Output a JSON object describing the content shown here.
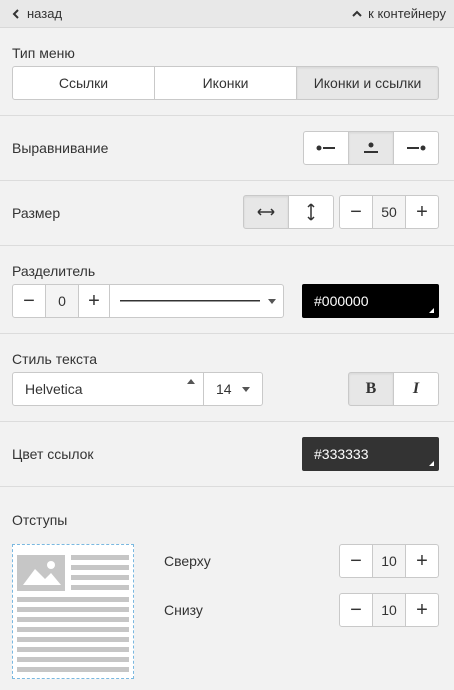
{
  "nav": {
    "back_label": "назад",
    "container_label": "к контейнеру"
  },
  "menu_type": {
    "label": "Тип меню",
    "options": [
      "Ссылки",
      "Иконки",
      "Иконки и ссылки"
    ],
    "selected": "Иконки и ссылки"
  },
  "alignment": {
    "label": "Выравнивание",
    "options": [
      "align-left-icon",
      "align-center-icon",
      "align-right-icon"
    ],
    "selected": "align-center-icon"
  },
  "size": {
    "label": "Размер",
    "modes": [
      "width-icon",
      "height-icon"
    ],
    "selected_mode": "width-icon",
    "minus": "−",
    "value": "50",
    "plus": "+"
  },
  "divider": {
    "label": "Разделитель",
    "minus": "−",
    "value": "0",
    "plus": "+",
    "style_icon": "solid-line-icon",
    "color": "#000000"
  },
  "text_style": {
    "label": "Стиль текста",
    "font": "Helvetica",
    "size": "14",
    "bold_label": "B",
    "italic_label": "I",
    "bold_active": true
  },
  "link_color": {
    "label": "Цвет ссылок",
    "color": "#333333"
  },
  "padding": {
    "label": "Отступы",
    "top_label": "Сверху",
    "top_value": "10",
    "bottom_label": "Снизу",
    "bottom_value": "10",
    "minus": "−",
    "plus": "+"
  }
}
